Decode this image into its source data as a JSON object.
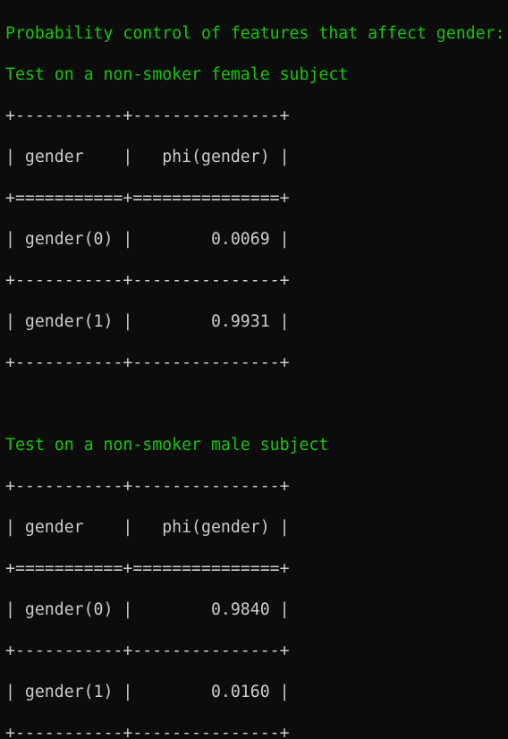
{
  "heading": "Probability control of features that affect gender:",
  "tables": [
    {
      "title": "Test on a non-smoker female subject",
      "lines": [
        "+-----------+---------------+",
        "| gender    |   phi(gender) |",
        "+===========+===============+",
        "| gender(0) |        0.0069 |",
        "+-----------+---------------+",
        "| gender(1) |        0.9931 |",
        "+-----------+---------------+"
      ]
    },
    {
      "title": "Test on a non-smoker male subject",
      "lines": [
        "+-----------+---------------+",
        "| gender    |   phi(gender) |",
        "+===========+===============+",
        "| gender(0) |        0.9840 |",
        "+-----------+---------------+",
        "| gender(1) |        0.0160 |",
        "+-----------+---------------+"
      ]
    }
  ]
}
